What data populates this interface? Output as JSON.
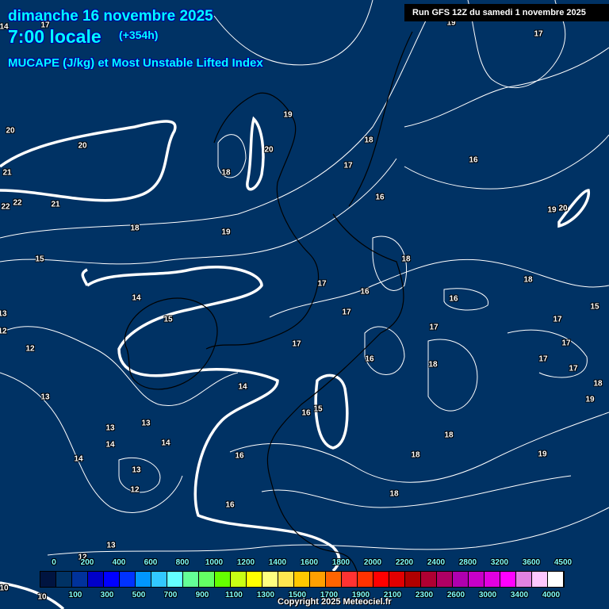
{
  "header": {
    "date": "dimanche 16 novembre 2025",
    "hour": "7:00 locale",
    "lead": "(+354h)",
    "parameter": "MUCAPE (J/kg) et Most Unstable Lifted Index",
    "run": "Run GFS 12Z du samedi 1 novembre 2025"
  },
  "contour_labels": [
    "14",
    "17",
    "19",
    "17",
    "19",
    "20",
    "20",
    "20",
    "18",
    "17",
    "16",
    "18",
    "21",
    "16",
    "22",
    "22",
    "21",
    "19",
    "20",
    "18",
    "19",
    "18",
    "15",
    "18",
    "17",
    "16",
    "16",
    "14",
    "17",
    "15",
    "15",
    "17",
    "17",
    "13",
    "12",
    "17",
    "17",
    "12",
    "16",
    "17",
    "18",
    "17",
    "14",
    "18",
    "13",
    "15",
    "16",
    "19",
    "13",
    "13",
    "18",
    "14",
    "14",
    "16",
    "18",
    "19",
    "14",
    "13",
    "12",
    "18",
    "16",
    "13",
    "12",
    "10",
    "10"
  ],
  "legend": {
    "top_labels": [
      "0",
      "200",
      "400",
      "600",
      "800",
      "1000",
      "1200",
      "1400",
      "1600",
      "1800",
      "2000",
      "2200",
      "2400",
      "2800",
      "3200",
      "3600",
      "4500"
    ],
    "bottom_labels": [
      "100",
      "300",
      "500",
      "700",
      "900",
      "1100",
      "1300",
      "1500",
      "1700",
      "1900",
      "2100",
      "2300",
      "2600",
      "3000",
      "3400",
      "4000"
    ],
    "colors": [
      "#001440",
      "#003264",
      "#00329b",
      "#0000c8",
      "#0000ff",
      "#0032ff",
      "#0096ff",
      "#32c8ff",
      "#64ffff",
      "#64ff96",
      "#64ff64",
      "#64ff00",
      "#c8ff14",
      "#ffff00",
      "#ffff80",
      "#ffe650",
      "#ffc800",
      "#ffa000",
      "#ff6400",
      "#ff3232",
      "#ff3200",
      "#ff0000",
      "#e10000",
      "#af0000",
      "#af0032",
      "#af0064",
      "#af00af",
      "#c800c8",
      "#e100e1",
      "#ff00ff",
      "#e182e1",
      "#ffc8ff",
      "#ffffff"
    ]
  },
  "copyright": "Copyright 2025 Meteociel.fr"
}
